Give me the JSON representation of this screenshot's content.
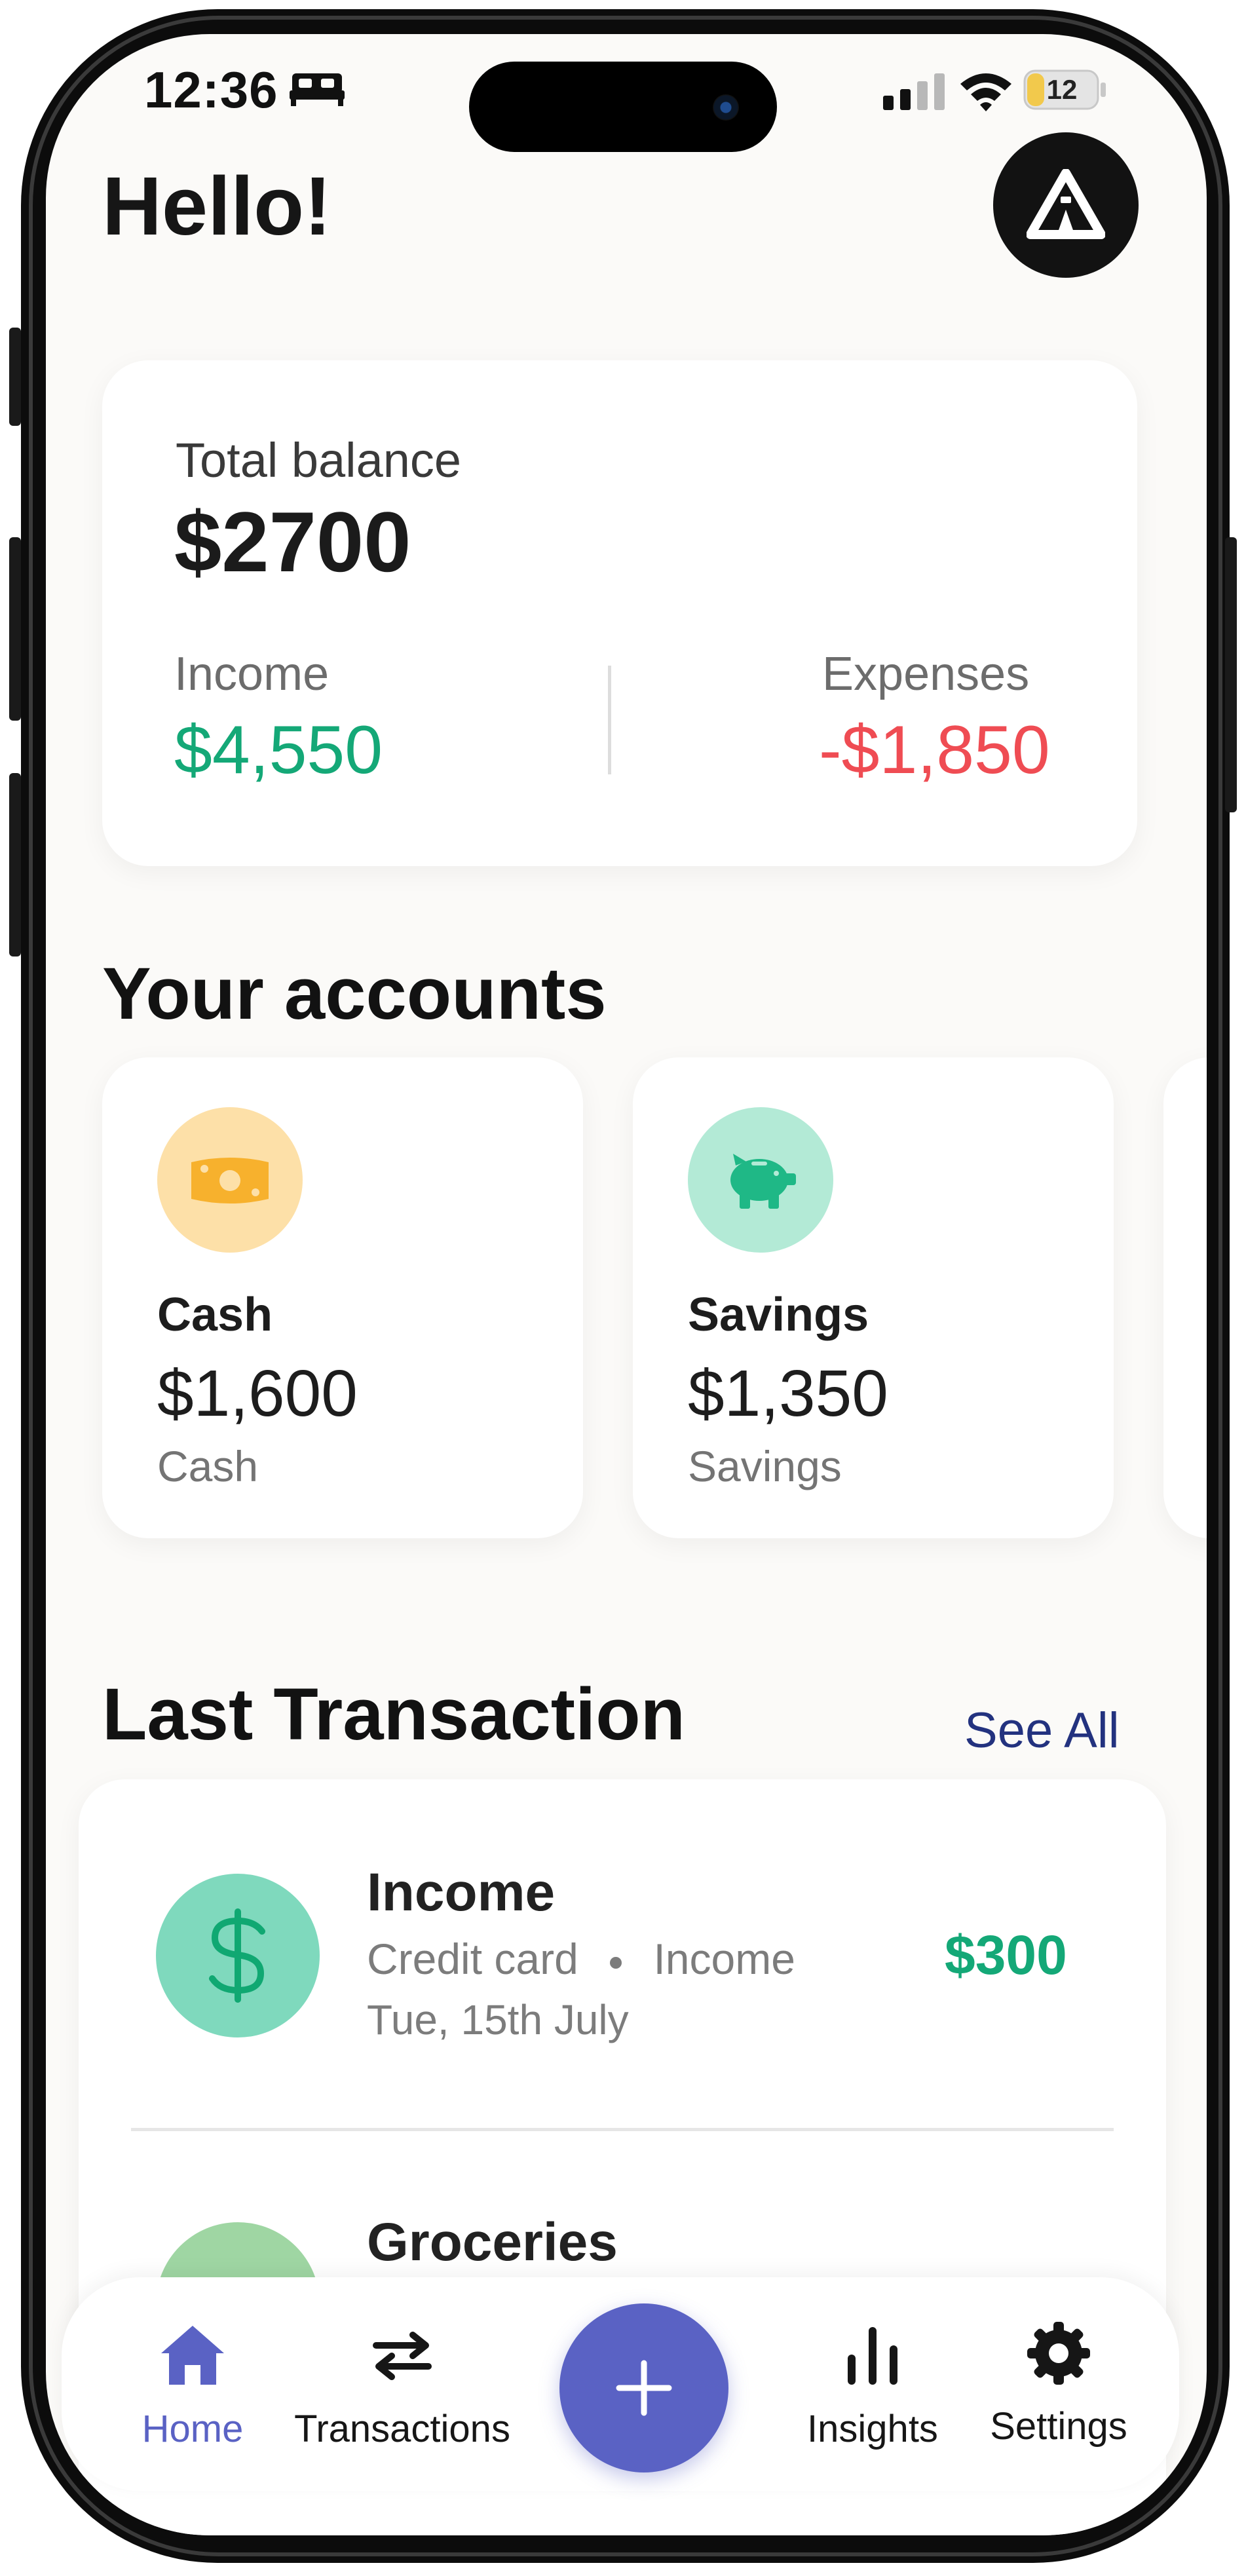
{
  "status_bar": {
    "time": "12:36",
    "battery": "12",
    "icons": [
      "bed-icon",
      "signal-icon",
      "wifi-icon",
      "battery-icon"
    ]
  },
  "header": {
    "greeting": "Hello!",
    "avatar_icon": "tent-logo-icon"
  },
  "balance": {
    "label": "Total balance",
    "amount": "$2700",
    "income_label": "Income",
    "income_amount": "$4,550",
    "expenses_label": "Expenses",
    "expenses_amount": "-$1,850",
    "income_color": "#14a877",
    "expenses_color": "#ef4c53"
  },
  "accounts": {
    "title": "Your accounts",
    "items": [
      {
        "name": "Cash",
        "balance": "$1,600",
        "type": "Cash",
        "icon": "cash-icon",
        "icon_bg": "#fde0a8",
        "icon_color": "#f7b12d"
      },
      {
        "name": "Savings",
        "balance": "$1,350",
        "type": "Savings",
        "icon": "piggy-bank-icon",
        "icon_bg": "#b3ead6",
        "icon_color": "#1fb886"
      }
    ]
  },
  "transactions": {
    "title": "Last Transaction",
    "see_all": "See All",
    "items": [
      {
        "name": "Income",
        "method": "Credit card",
        "category": "Income",
        "date": "Tue, 15th July",
        "amount": "$300",
        "icon": "dollar-icon"
      },
      {
        "name": "Groceries",
        "icon": "groceries-icon"
      }
    ]
  },
  "nav": {
    "items": [
      {
        "label": "Home",
        "icon": "home-icon",
        "active": true
      },
      {
        "label": "Transactions",
        "icon": "swap-arrows-icon"
      },
      {
        "label": "Insights",
        "icon": "bar-chart-icon"
      },
      {
        "label": "Settings",
        "icon": "gear-icon"
      }
    ],
    "fab_icon": "plus-icon",
    "active_color": "#5a62c4"
  }
}
